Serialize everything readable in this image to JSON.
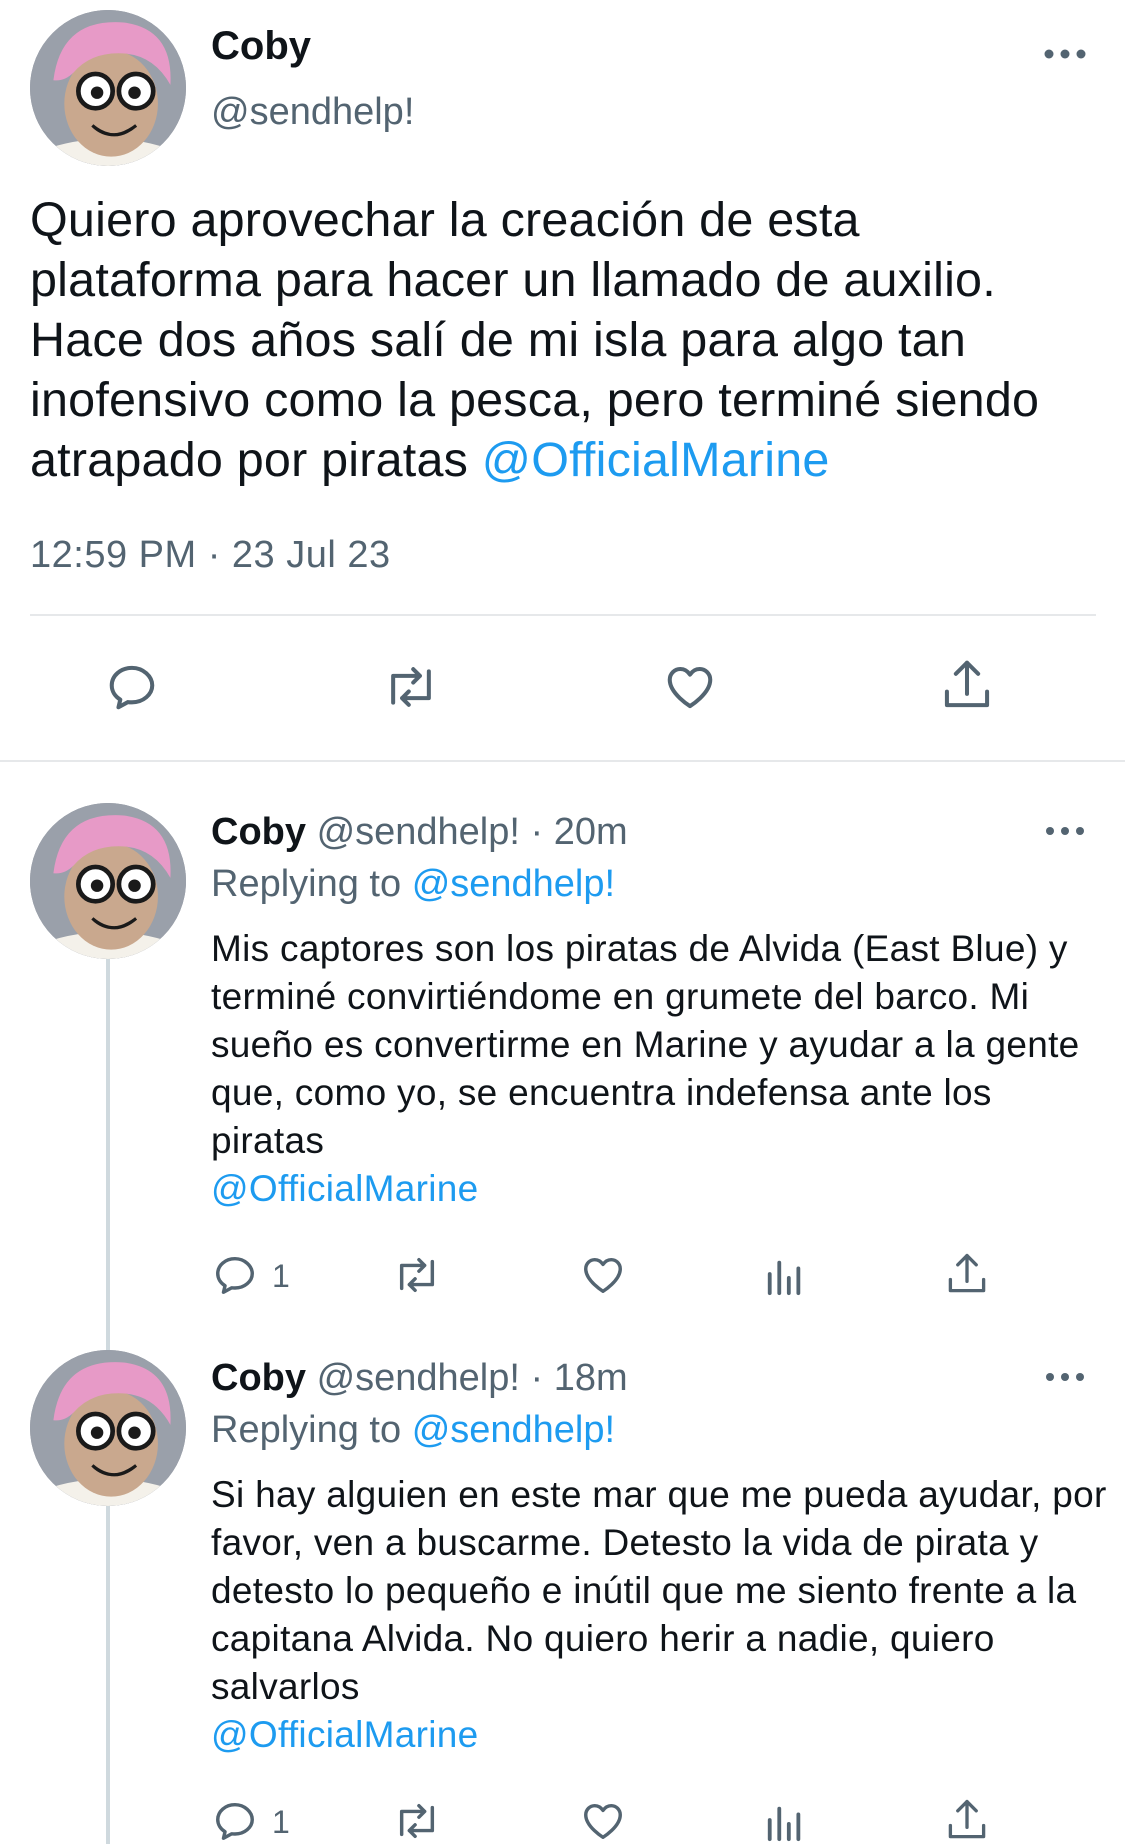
{
  "main_tweet": {
    "name": "Coby",
    "handle": "@sendhelp!",
    "text": "Quiero aprovechar la creación de esta plataforma para hacer un llamado de auxilio. Hace dos años salí de mi isla para algo tan inofensivo como la pesca, pero terminé siendo atrapado por piratas ",
    "mention": "@OfficialMarine",
    "timestamp": "12:59 PM · 23 Jul 23",
    "actions": [
      "reply-icon",
      "retweet-icon",
      "like-icon",
      "share-icon"
    ]
  },
  "replies": [
    {
      "name": "Coby",
      "handle": "@sendhelp!",
      "time": "· 20m",
      "replying_prefix": "Replying to",
      "replying_to": "@sendhelp!",
      "text": "Mis captores son los piratas de Alvida (East Blue) y terminé convirtiéndome en grumete del barco. Mi sueño es convertirme en Marine y ayudar a la gente que, como yo, se encuentra indefensa ante los piratas",
      "mention": "@OfficialMarine",
      "reply_count": "1"
    },
    {
      "name": "Coby",
      "handle": "@sendhelp!",
      "time": "· 18m",
      "replying_prefix": "Replying to",
      "replying_to": "@sendhelp!",
      "text": "Si hay alguien en este mar que me pueda ayudar, por favor, ven a buscarme. Detesto la vida de pirata y detesto lo pequeño e inútil que me siento frente a la capitana Alvida. No quiero herir a nadie, quiero salvarlos",
      "mention": "@OfficialMarine",
      "reply_count": "1"
    }
  ],
  "colors": {
    "text": "#0f1419",
    "secondary": "#536471",
    "accent": "#1d9bf0",
    "divider": "#e6e8ea",
    "thread_line": "#cfd9de"
  }
}
